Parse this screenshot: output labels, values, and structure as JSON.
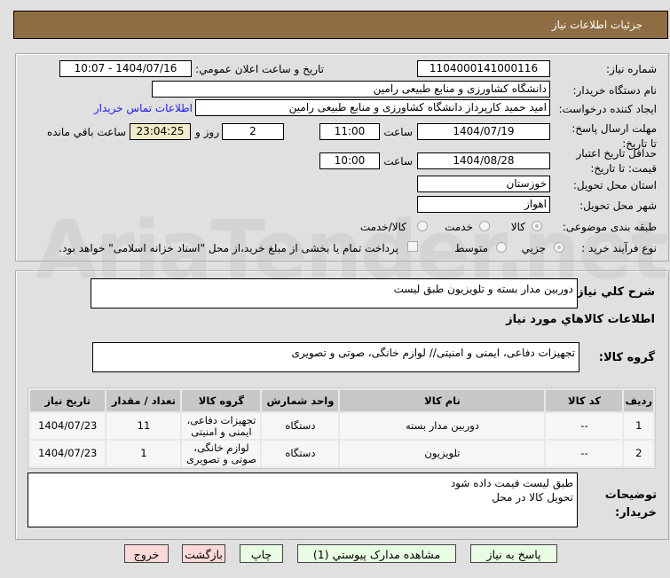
{
  "header": {
    "title": "جزئیات اطلاعات نیاز"
  },
  "fields": {
    "need_number_label": "شماره نیاز:",
    "need_number": "1104000141000116",
    "announce_label": "تاریخ و ساعت اعلان عمومي:",
    "announce_value": "1404/07/16 - 10:07",
    "buyer_label": "نام دستگاه خریدار:",
    "buyer": "دانشگاه کشاورزی و منابع طبیعی رامین",
    "creator_label": "ایجاد کننده درخواست:",
    "creator": "امید حمید کارپرداز دانشگاه کشاورزی و منابع طبیعی رامین",
    "contact_link": "اطلاعات تماس خریدار",
    "reply_label": "مهلت ارسال پاسخ: تا تاریخ:",
    "reply_date": "1404/07/19",
    "time_label": "ساعت",
    "reply_time": "11:00",
    "days": "2",
    "days_label": "روز و",
    "remaining": "23:04:25",
    "remaining_label": "ساعت باقي مانده",
    "validity_label": "حداقل تاریخ اعتبار قیمت: تا تاریخ:",
    "validity_date": "1404/08/28",
    "validity_time": "10:00",
    "province_label": "استان محل تحویل:",
    "province": "خوزستان",
    "city_label": "شهر محل تحویل:",
    "city": "اهواز",
    "category_label": "طبقه بندی موضوعی:",
    "category_options": [
      "کالا",
      "خدمت",
      "کالا/خدمت"
    ],
    "process_label": "نوع فرآیند خرید :",
    "process_options": [
      "جزیي",
      "متوسط"
    ],
    "payment_note": "پرداخت تمام یا بخشی از مبلغ خرید،از محل \"اسناد خزانه اسلامی\" خواهد بود."
  },
  "watermark": "AriaTender.net",
  "description": {
    "label": "شرح کلي نیاز:",
    "value": "دوربین مدار بسته و تلویزیون طبق لیست"
  },
  "goods_heading": "اطلاعات کالاهاي مورد نیاز",
  "goods_group": {
    "label": "گروه کالا:",
    "value": "تجهیزات دفاعی، ایمنی و امنیتی// لوازم خانگی، صوتی و تصویری"
  },
  "table": {
    "headers": [
      "ردیف",
      "کد کالا",
      "نام کالا",
      "واحد شمارش",
      "گروه کالا",
      "تعداد / مقدار",
      "تاریخ نیاز"
    ],
    "rows": [
      [
        "1",
        "--",
        "دوربین مدار بسته",
        "دستگاه",
        "تجهیزات دفاعی، ایمنی و امنیتی",
        "11",
        "1404/07/23"
      ],
      [
        "2",
        "--",
        "تلویزیون",
        "دستگاه",
        "لوازم خانگی، صوتی و تصویری",
        "1",
        "1404/07/23"
      ]
    ]
  },
  "notes": {
    "label": "توضیحات خریدار:",
    "line1": "طبق لیست قیمت داده شود",
    "line2": "تحویل کالا در محل"
  },
  "buttons": {
    "reply": "پاسخ به نیاز",
    "attachments": "مشاهده مدارک پیوستي (1)",
    "print": "چاپ",
    "back": "بازگشت",
    "exit": "خروج"
  }
}
